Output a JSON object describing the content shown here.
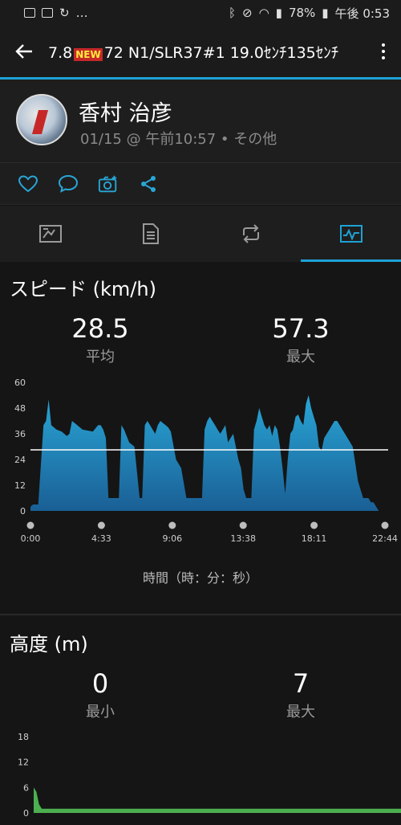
{
  "statusbar": {
    "battery": "78%",
    "time": "午後 0:53"
  },
  "appbar": {
    "title_pre": "7.8",
    "new_badge": "NEW",
    "title_post": "72 N1/SLR37#1 19.0ｾﾝﾁ135ｾﾝﾁ"
  },
  "profile": {
    "name": "香村 治彦",
    "date": "01/15 @ 午前10:57 • その他"
  },
  "speed": {
    "title": "スピード (km/h)",
    "avg_value": "28.5",
    "avg_label": "平均",
    "max_value": "57.3",
    "max_label": "最大",
    "xaxis_label": "時間（時：分：秒）"
  },
  "altitude": {
    "title": "高度 (m)",
    "min_value": "0",
    "min_label": "最小",
    "max_value": "7",
    "max_label": "最大"
  },
  "colors": {
    "accent": "#1ea1d6",
    "fill_top": "#29a6d6",
    "fill_bottom": "#1a5f95",
    "altitude": "#4caf50"
  },
  "chart_data": [
    {
      "type": "area",
      "ylim": [
        0,
        60
      ],
      "yticks": [
        "60",
        "48",
        "36",
        "24",
        "12",
        "0"
      ],
      "xticks": [
        "0:00",
        "4:33",
        "9:06",
        "13:38",
        "18:11",
        "22:44"
      ],
      "xlim": [
        0,
        1364
      ],
      "reference_line": 28.5,
      "x": [
        0,
        10,
        20,
        30,
        50,
        60,
        70,
        80,
        100,
        120,
        130,
        140,
        150,
        160,
        180,
        200,
        240,
        260,
        270,
        280,
        290,
        300,
        320,
        340,
        350,
        360,
        380,
        400,
        420,
        430,
        440,
        450,
        460,
        470,
        480,
        490,
        500,
        510,
        520,
        530,
        540,
        560,
        580,
        600,
        620,
        640,
        650,
        660,
        670,
        680,
        690,
        700,
        710,
        720,
        730,
        740,
        750,
        760,
        770,
        780,
        790,
        800,
        810,
        820,
        830,
        840,
        850,
        860,
        870,
        880,
        890,
        900,
        910,
        920,
        930,
        940,
        950,
        960,
        970,
        980,
        990,
        1000,
        1010,
        1020,
        1030,
        1040,
        1050,
        1060,
        1070,
        1080,
        1090,
        1100,
        1110,
        1120,
        1130,
        1140,
        1150,
        1160,
        1170,
        1180,
        1190,
        1200,
        1210,
        1220,
        1230,
        1240,
        1250,
        1260,
        1270,
        1280,
        1290,
        1300,
        1310,
        1320,
        1330,
        1340,
        1350,
        1364
      ],
      "values": [
        2,
        3,
        3,
        3,
        40,
        42,
        52,
        40,
        38,
        37,
        36,
        35,
        36,
        42,
        40,
        38,
        37,
        40,
        40,
        38,
        34,
        6,
        6,
        6,
        40,
        38,
        32,
        30,
        6,
        6,
        40,
        42,
        40,
        38,
        36,
        40,
        42,
        41,
        40,
        39,
        37,
        24,
        20,
        6,
        6,
        6,
        6,
        6,
        38,
        42,
        44,
        42,
        40,
        38,
        36,
        38,
        40,
        32,
        34,
        36,
        30,
        24,
        20,
        10,
        6,
        6,
        6,
        38,
        42,
        48,
        44,
        40,
        38,
        40,
        35,
        40,
        38,
        30,
        20,
        8,
        24,
        36,
        38,
        44,
        45,
        42,
        40,
        50,
        54,
        48,
        44,
        40,
        30,
        28,
        34,
        36,
        38,
        40,
        42,
        42,
        40,
        38,
        36,
        34,
        32,
        30,
        22,
        14,
        10,
        6,
        6,
        6,
        4,
        4,
        2,
        0
      ],
      "ylabel": "スピード (km/h)",
      "xlabel": "時間（時：分：秒）"
    },
    {
      "type": "area",
      "ylim": [
        0,
        18
      ],
      "yticks": [
        "18",
        "12",
        "6",
        "0"
      ],
      "x": [
        0,
        10,
        20,
        30,
        40,
        1364
      ],
      "values": [
        6,
        5,
        2,
        1,
        1,
        1
      ],
      "ylabel": "高度 (m)"
    }
  ]
}
